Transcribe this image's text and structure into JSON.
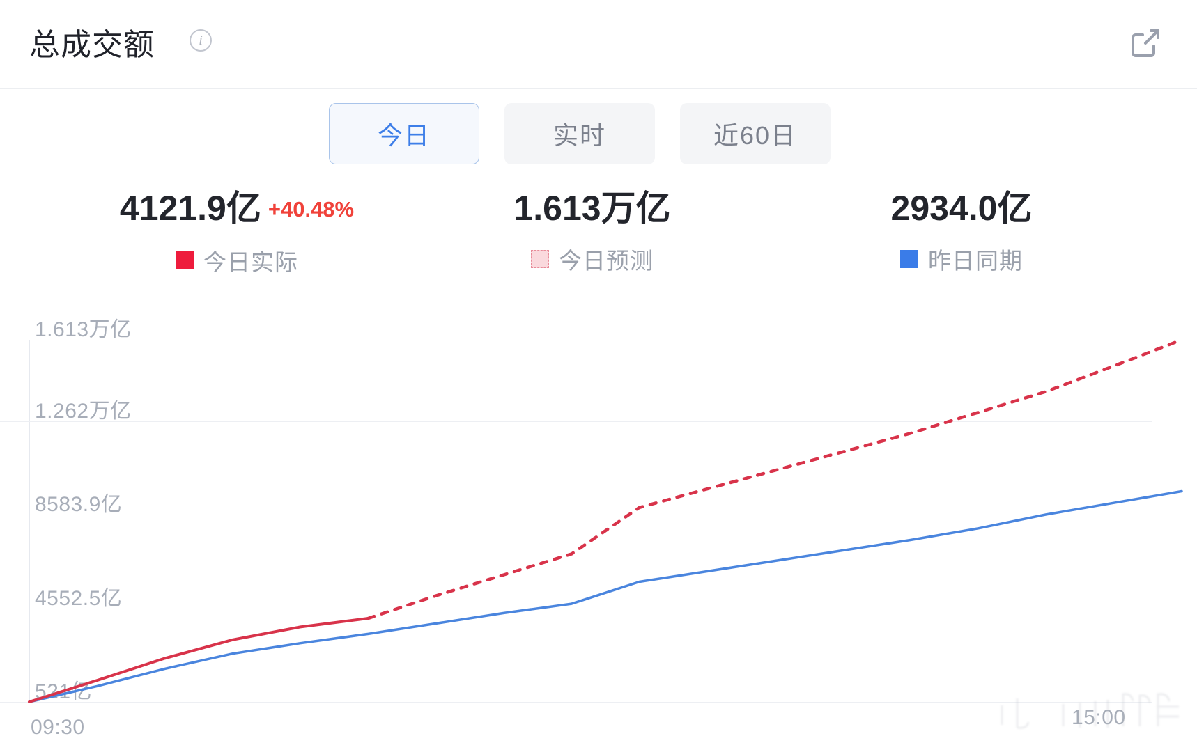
{
  "header": {
    "title": "总成交额",
    "info_icon": "info-icon",
    "external_icon": "external-link-icon"
  },
  "tabs": [
    {
      "label": "今日",
      "active": true
    },
    {
      "label": "实时",
      "active": false
    },
    {
      "label": "近60日",
      "active": false
    }
  ],
  "stats": [
    {
      "value": "4121.9亿",
      "change": "+40.48%",
      "legend": "今日实际",
      "swatch": "swatch-actual",
      "color": "#ee1c3c"
    },
    {
      "value": "1.613万亿",
      "change": "",
      "legend": "今日预测",
      "swatch": "swatch-forecast",
      "color": "#fad9dd"
    },
    {
      "value": "2934.0亿",
      "change": "",
      "legend": "昨日同期",
      "swatch": "swatch-yesterday",
      "color": "#3a7ce8"
    }
  ],
  "colors": {
    "accent_red": "#ee1c3c",
    "accent_blue": "#3a7ce8",
    "change_red": "#f0423a",
    "grid": "#edeff3",
    "axis_text": "#a7adb8"
  },
  "chart_data": {
    "type": "line",
    "title": "总成交额",
    "xlabel": "",
    "ylabel": "",
    "grid": true,
    "legend_position": "top",
    "y_tick_labels": [
      "1.613万亿",
      "1.262万亿",
      "8583.9亿",
      "4552.5亿",
      "521亿"
    ],
    "y_tick_values": [
      16130,
      12620,
      8583.9,
      4552.5,
      521
    ],
    "ylim": [
      521,
      16130
    ],
    "x_tick_labels": [
      "09:30",
      "15:00"
    ],
    "x": [
      "09:30",
      "09:45",
      "10:00",
      "10:15",
      "10:30",
      "10:45",
      "11:00",
      "11:15",
      "11:30",
      "13:00",
      "13:15",
      "13:30",
      "13:45",
      "14:00",
      "14:15",
      "14:30",
      "14:45",
      "15:00"
    ],
    "series": [
      {
        "name": "今日实际",
        "style": "solid",
        "color": "#ee1c3c",
        "values": [
          521,
          1450,
          2400,
          3200,
          3750,
          4121.9,
          null,
          null,
          null,
          null,
          null,
          null,
          null,
          null,
          null,
          null,
          null,
          null
        ]
      },
      {
        "name": "今日预测",
        "style": "dotted",
        "color": "#ee1c3c",
        "values": [
          null,
          null,
          null,
          null,
          null,
          4121.9,
          5100,
          6000,
          6900,
          8900,
          9700,
          10500,
          11300,
          12100,
          13000,
          13900,
          15000,
          16130
        ]
      },
      {
        "name": "昨日同期",
        "style": "solid",
        "color": "#3a7ce8",
        "values": [
          521,
          1200,
          1950,
          2600,
          3050,
          3450,
          3900,
          4350,
          4750,
          5700,
          6150,
          6600,
          7050,
          7500,
          8000,
          8600,
          9100,
          9600
        ]
      }
    ],
    "annotations": [
      {
        "text": "+40.48%",
        "color": "#f0423a"
      }
    ]
  },
  "axis": {
    "x_left": "09:30",
    "x_right": "15:00"
  }
}
